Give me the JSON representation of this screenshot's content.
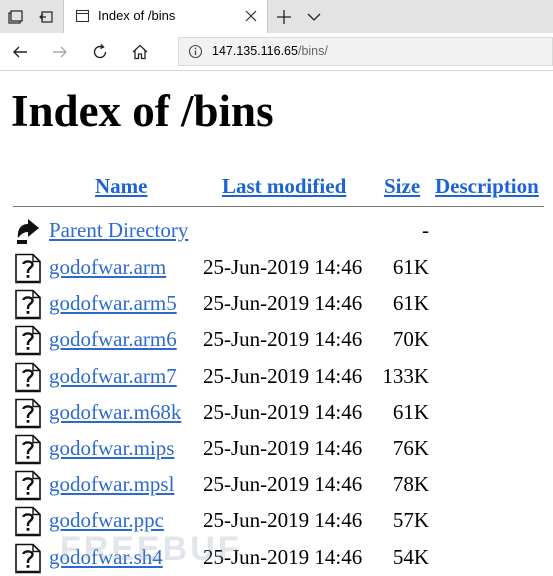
{
  "browser": {
    "tab_title": "Index of /bins",
    "address_host": "147.135.116.65",
    "address_path": "/bins/"
  },
  "page": {
    "title": "Index of /bins",
    "columns": {
      "name": "Name",
      "last_modified": "Last modified",
      "size": "Size",
      "description": "Description"
    },
    "parent": {
      "name": "Parent Directory",
      "size": "-"
    },
    "files": [
      {
        "name": "godofwar.arm",
        "modified": "25-Jun-2019 14:46",
        "size": "61K"
      },
      {
        "name": "godofwar.arm5",
        "modified": "25-Jun-2019 14:46",
        "size": "61K"
      },
      {
        "name": "godofwar.arm6",
        "modified": "25-Jun-2019 14:46",
        "size": "70K"
      },
      {
        "name": "godofwar.arm7",
        "modified": "25-Jun-2019 14:46",
        "size": "133K"
      },
      {
        "name": "godofwar.m68k",
        "modified": "25-Jun-2019 14:46",
        "size": "61K"
      },
      {
        "name": "godofwar.mips",
        "modified": "25-Jun-2019 14:46",
        "size": "76K"
      },
      {
        "name": "godofwar.mpsl",
        "modified": "25-Jun-2019 14:46",
        "size": "78K"
      },
      {
        "name": "godofwar.ppc",
        "modified": "25-Jun-2019 14:46",
        "size": "57K"
      },
      {
        "name": "godofwar.sh4",
        "modified": "25-Jun-2019 14:46",
        "size": "54K"
      }
    ]
  },
  "watermark": "FREEBUF",
  "colors": {
    "link": "#2c6ad1",
    "header_link": "#1d63d6",
    "tabbar": "#e3e3e3"
  },
  "icons": [
    "tab-manager-icon",
    "set-aside-tabs-icon",
    "page-icon",
    "close-icon",
    "new-tab-icon",
    "chevron-down-icon",
    "back-icon",
    "forward-icon",
    "refresh-icon",
    "home-icon",
    "info-icon",
    "parent-directory-icon",
    "unknown-file-icon"
  ]
}
